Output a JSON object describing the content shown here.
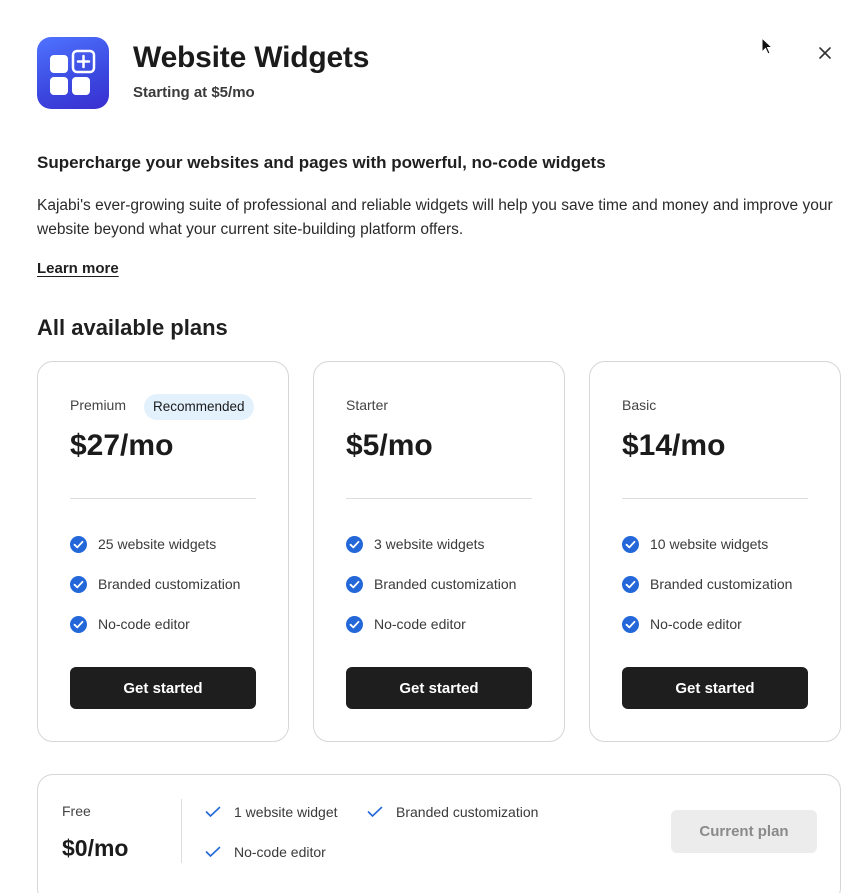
{
  "header": {
    "app_title": "Website Widgets",
    "subtitle": "Starting at $5/mo",
    "app_icon": "widgets-grid-plus-icon",
    "close_icon": "close-icon"
  },
  "intro": {
    "headline": "Supercharge your websites and pages with powerful, no-code widgets",
    "description": "Kajabi's ever-growing suite of professional and reliable widgets will help you save time and money and improve your website beyond what your current site-building platform offers.",
    "learn_more": "Learn more"
  },
  "plans_heading": "All available plans",
  "plans": [
    {
      "name": "Premium",
      "badge": "Recommended",
      "price": "$27/mo",
      "features": [
        "25 website widgets",
        "Branded customization",
        "No-code editor"
      ],
      "cta": "Get started"
    },
    {
      "name": "Starter",
      "price": "$5/mo",
      "features": [
        "3 website widgets",
        "Branded customization",
        "No-code editor"
      ],
      "cta": "Get started"
    },
    {
      "name": "Basic",
      "price": "$14/mo",
      "features": [
        "10 website widgets",
        "Branded customization",
        "No-code editor"
      ],
      "cta": "Get started"
    }
  ],
  "free_plan": {
    "name": "Free",
    "price": "$0/mo",
    "features": [
      "1 website widget",
      "Branded customization",
      "No-code editor"
    ],
    "cta": "Current plan"
  },
  "colors": {
    "accent_blue": "#2467d8",
    "button_dark": "#1e1e1e",
    "badge_bg": "#e3f1fd",
    "icon_gradient_start": "#4f73ff",
    "icon_gradient_end": "#3a2fd0"
  }
}
